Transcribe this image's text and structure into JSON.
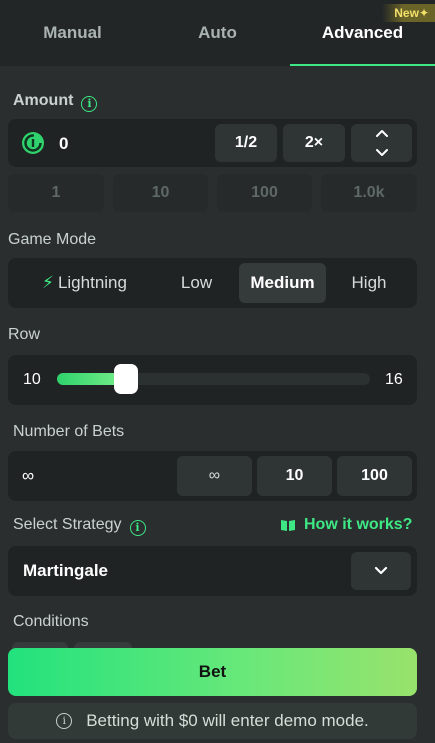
{
  "tabs": [
    {
      "label": "Manual",
      "active": false
    },
    {
      "label": "Auto",
      "active": false
    },
    {
      "label": "Advanced",
      "active": true
    }
  ],
  "new_badge": "New",
  "amount": {
    "label": "Amount",
    "value": "0",
    "half_label": "1/2",
    "double_label": "2×",
    "quick_values": [
      "1",
      "10",
      "100",
      "1.0k"
    ]
  },
  "game_mode": {
    "label": "Game Mode",
    "options": [
      "Lightning",
      "Low",
      "Medium",
      "High"
    ],
    "selected": "Medium"
  },
  "row": {
    "label": "Row",
    "min": "10",
    "max": "16",
    "level_fraction": 0.22
  },
  "bets": {
    "label": "Number of Bets",
    "value": "∞",
    "options": [
      "∞",
      "10",
      "100"
    ]
  },
  "strategy": {
    "label": "Select Strategy",
    "how_it_works": "How it works?",
    "selected": "Martingale"
  },
  "conditions": {
    "label": "Conditions"
  },
  "bet_button": "Bet",
  "demo_notice": "Betting with $0 will enter demo mode.",
  "colors": {
    "accent": "#3ee884",
    "background": "#2a2e2e",
    "panel": "#1f2323"
  }
}
